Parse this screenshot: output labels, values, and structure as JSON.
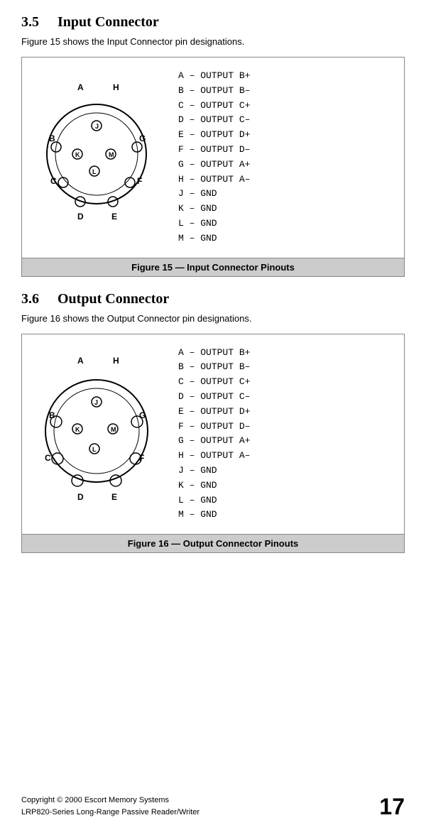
{
  "page": {
    "sections": [
      {
        "number": "3.5",
        "title": "Input Connector",
        "description": "Figure 15 shows the Input Connector pin designations.",
        "figure_id": "figure-15",
        "caption": "Figure 15 — Input Connector Pinouts",
        "pins": [
          "A  –  OUTPUT B+",
          "B  –  OUTPUT B–",
          "C  –  OUTPUT C+",
          "D  –  OUTPUT C–",
          "E  –  OUTPUT D+",
          "F  –  OUTPUT D–",
          "G  –  OUTPUT A+",
          "H  –  OUTPUT A–",
          "J  –  GND",
          "K  –  GND",
          "L  –  GND",
          "M  –  GND"
        ],
        "connector_labels": {
          "top_left": "A",
          "top_right": "H",
          "mid_left": "B",
          "mid_right": "G",
          "inner_top": "J",
          "inner_left": "K",
          "inner_center": "M",
          "inner_bottom": "L",
          "bot_left": "C",
          "bot_right": "F",
          "bot2_left": "D",
          "bot2_right": "E"
        }
      },
      {
        "number": "3.6",
        "title": "Output Connector",
        "description": "Figure 16 shows the Output Connector pin designations.",
        "figure_id": "figure-16",
        "caption": "Figure 16 — Output Connector Pinouts",
        "pins": [
          "A  –  OUTPUT B+",
          "B  –  OUTPUT B–",
          "C  –  OUTPUT C+",
          "D  –  OUTPUT C–",
          "E  –  OUTPUT D+",
          "F  –  OUTPUT D–",
          "G  –  OUTPUT A+",
          "H  –  OUTPUT A–",
          "J  –  GND",
          "K  –  GND",
          "L  –  GND",
          "M  –  GND"
        ],
        "connector_labels": {
          "top_left": "A",
          "top_right": "H",
          "mid_left": "B",
          "mid_right": "G",
          "inner_top": "J",
          "inner_left": "K",
          "inner_center": "M",
          "inner_bottom": "L",
          "bot_left": "C",
          "bot_right": "F",
          "bot2_left": "D",
          "bot2_right": "E"
        }
      }
    ],
    "footer": {
      "line1": "Copyright © 2000 Escort Memory Systems",
      "line2": "LRP820-Series Long-Range Passive Reader/Writer",
      "page_number": "17"
    }
  }
}
